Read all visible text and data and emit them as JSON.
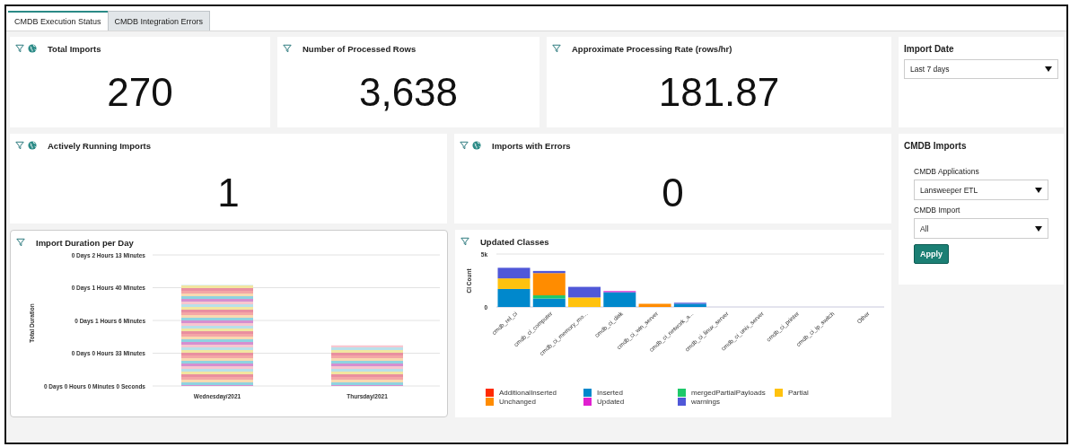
{
  "tabs": [
    {
      "label": "CMDB Execution Status",
      "selected": true
    },
    {
      "label": "CMDB Integration Errors",
      "selected": false
    }
  ],
  "score_cards": [
    {
      "title": "Total Imports",
      "shared": true,
      "value": "270"
    },
    {
      "title": "Number of Processed Rows",
      "shared": false,
      "value": "3,638"
    },
    {
      "title": "Approximate Processing Rate (rows/hr)",
      "shared": false,
      "value": "181.87"
    },
    {
      "title": "Actively Running Imports",
      "shared": true,
      "value": "1"
    },
    {
      "title": "Imports with Errors",
      "shared": true,
      "value": "0"
    }
  ],
  "import_duration_chart": {
    "title": "Import Duration per Day",
    "axis_title": "Total Duration",
    "axis_labels": [
      "0 Days 2 Hours 13 Minutes",
      "0 Days 1 Hours 40 Minutes",
      "0 Days 1 Hours 6 Minutes",
      "0 Days 0 Hours 33 Minutes",
      "0 Days 0 Hours 0 Minutes 0 Seconds"
    ],
    "categories": [
      "Wednesday/2021",
      "Thursday/2021"
    ]
  },
  "updated_classes_chart": {
    "title": "Updated Classes",
    "chart_data": {
      "type": "bar",
      "stacked": true,
      "legend": "bottom",
      "ylabel": "CI Count",
      "categories": [
        "cmdb_rel_ci",
        "cmdb_ci_computer",
        "cmdb_ci_memory_mo...",
        "cmdb_ci_disk",
        "cmdb_ci_win_server",
        "cmdb_ci_network_a...",
        "cmdb_ci_linux_server",
        "cmdb_ci_unix_server",
        "cmdb_ci_printer",
        "cmdb_ci_ip_switch",
        "Other"
      ],
      "ylim": [
        0,
        5000
      ],
      "yticks": [
        {
          "value": 0,
          "label": "0"
        },
        {
          "value": 5000,
          "label": "5k"
        }
      ],
      "series": [
        {
          "name": "AdditionalInserted",
          "color": "#ff2a00",
          "values": [
            0,
            0,
            0,
            0,
            0,
            0,
            0,
            0,
            0,
            0,
            0
          ]
        },
        {
          "name": "Inserted",
          "color": "#0088cc",
          "values": [
            1700,
            800,
            0,
            1400,
            0,
            300,
            0,
            0,
            0,
            0,
            0
          ]
        },
        {
          "name": "mergedPartialPayloads",
          "color": "#1ec96a",
          "values": [
            0,
            300,
            0,
            0,
            0,
            0,
            0,
            0,
            0,
            0,
            0
          ]
        },
        {
          "name": "Partial",
          "color": "#ffc20e",
          "values": [
            1000,
            0,
            900,
            0,
            0,
            0,
            0,
            0,
            0,
            0,
            0
          ]
        },
        {
          "name": "Unchanged",
          "color": "#ff8c00",
          "values": [
            0,
            2100,
            0,
            0,
            300,
            0,
            0,
            0,
            0,
            0,
            0
          ]
        },
        {
          "name": "Updated",
          "color": "#e020d0",
          "values": [
            0,
            0,
            0,
            100,
            0,
            0,
            0,
            0,
            0,
            0,
            0
          ]
        },
        {
          "name": "warnings",
          "color": "#5058d8",
          "values": [
            1000,
            200,
            1000,
            0,
            0,
            100,
            0,
            0,
            0,
            0,
            0
          ]
        }
      ]
    }
  },
  "import_date_filter": {
    "title": "Import Date",
    "value": "Last 7 days"
  },
  "cmdb_imports_filter": {
    "title": "CMDB Imports",
    "fields": [
      {
        "label": "CMDB Applications",
        "value": "Lansweeper ETL"
      },
      {
        "label": "CMDB Import",
        "value": "All"
      }
    ],
    "button": "Apply"
  }
}
